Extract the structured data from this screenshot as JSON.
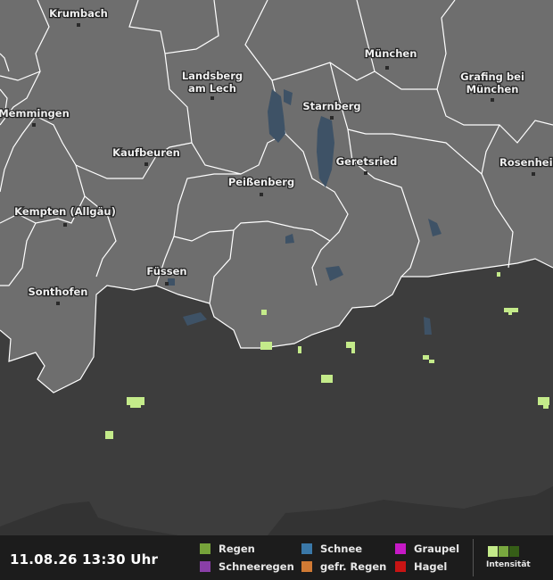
{
  "map": {
    "cities": [
      {
        "name": "Krumbach"
      },
      {
        "name": "München"
      },
      {
        "name": "Landsberg"
      },
      {
        "name": "am Lech"
      },
      {
        "name": "Grafing bei"
      },
      {
        "name": "München"
      },
      {
        "name": "Memmingen"
      },
      {
        "name": "Starnberg"
      },
      {
        "name": "Kaufbeuren"
      },
      {
        "name": "Geretsried"
      },
      {
        "name": "Rosenheim"
      },
      {
        "name": "Peißenberg"
      },
      {
        "name": "Kempten (Allgäu)"
      },
      {
        "name": "Füssen"
      },
      {
        "name": "Sonthofen"
      }
    ],
    "colors": {
      "germany": "#6e6e6e",
      "austria": "#3d3d3d",
      "borders": "#ffffff",
      "water": "#3e5266",
      "precip": "#c4eb8a"
    }
  },
  "footer": {
    "timestamp": "11.08.26 13:30 Uhr",
    "legend": [
      {
        "label": "Regen",
        "color": "#76a33a"
      },
      {
        "label": "Schneeregen",
        "color": "#8a3fa8"
      },
      {
        "label": "Schnee",
        "color": "#3a78a8"
      },
      {
        "label": "gefr. Regen",
        "color": "#d07a34"
      },
      {
        "label": "Graupel",
        "color": "#c619c6"
      },
      {
        "label": "Hagel",
        "color": "#c81414"
      }
    ],
    "intensity_label": "Intensität",
    "intensity_colors": [
      "#c4eb8a",
      "#79a83f",
      "#365e17"
    ]
  }
}
